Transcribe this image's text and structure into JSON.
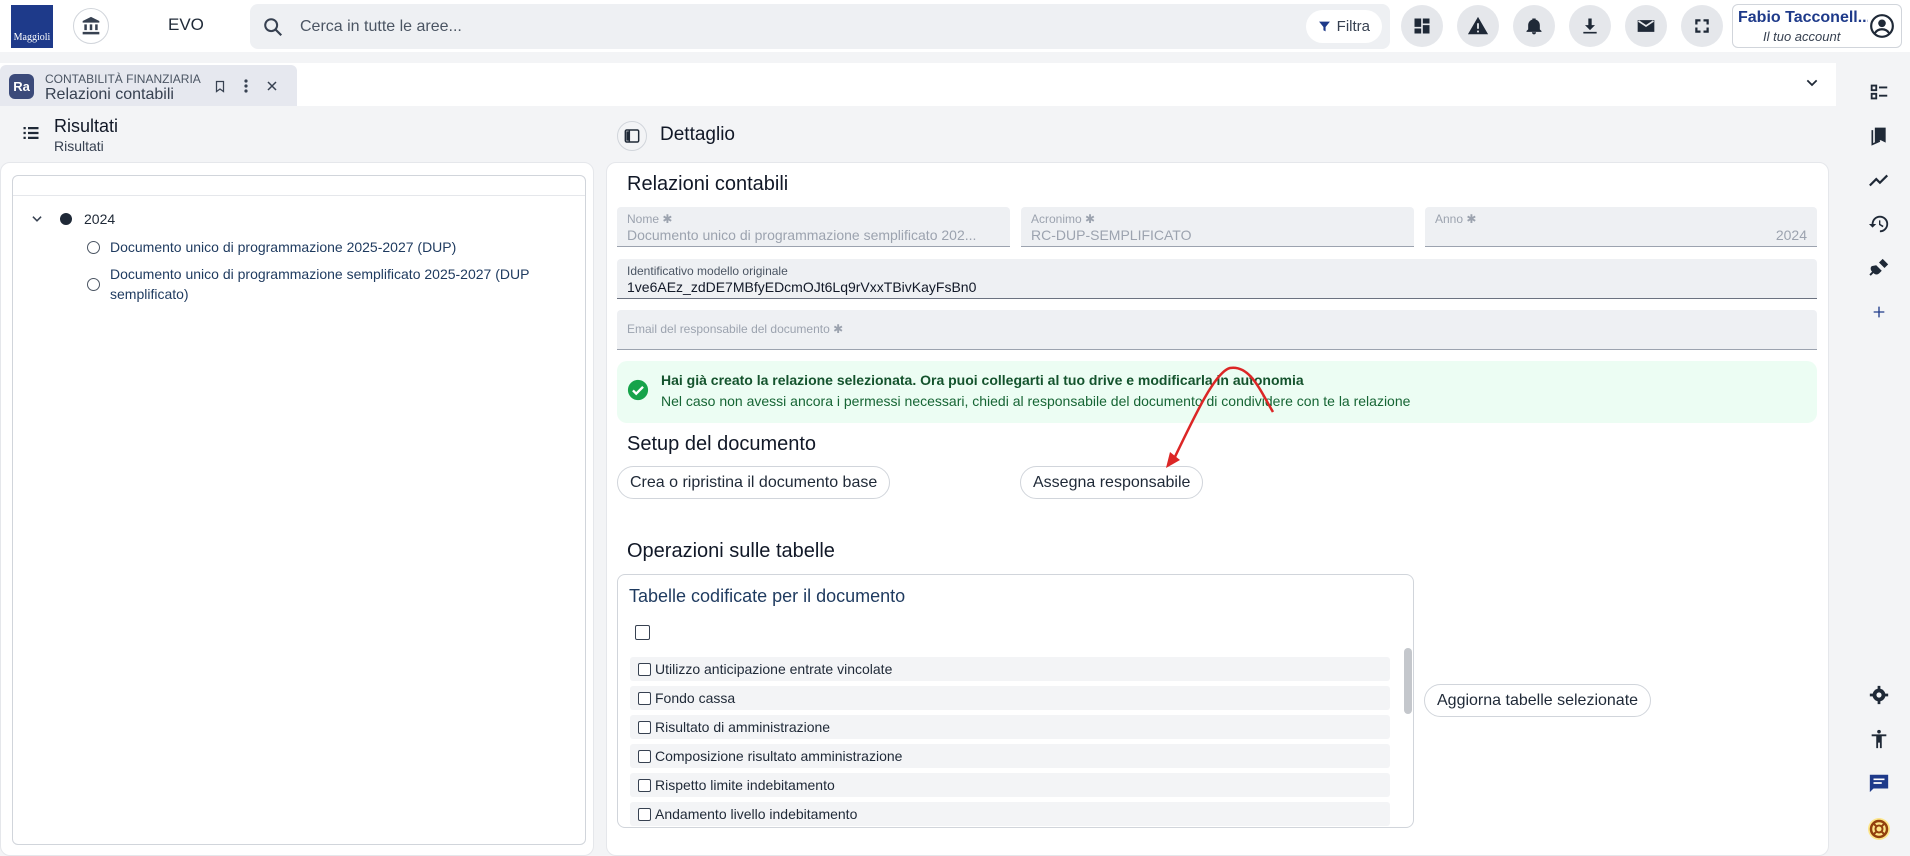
{
  "topbar": {
    "logo_text": "Maggioli",
    "app_name": "EVO",
    "search_placeholder": "Cerca in tutte le aree...",
    "filter_label": "Filtra",
    "user_name": "Fabio Tacconell...",
    "user_sub": "Il tuo account"
  },
  "tab": {
    "badge": "Ra",
    "category": "CONTABILITÀ FINANZIARIA",
    "title": "Relazioni contabili"
  },
  "left_panel": {
    "title": "Risultati",
    "subtitle": "Risultati",
    "tree": {
      "year": "2024",
      "items": [
        {
          "label": "Documento unico di programmazione 2025-2027 (DUP)"
        },
        {
          "label": "Documento unico di programmazione semplificato 2025-2027 (DUP semplificato)"
        }
      ]
    }
  },
  "detail": {
    "header": "Dettaglio",
    "section_title": "Relazioni contabili",
    "fields": {
      "nome": {
        "label": "Nome ✱",
        "value": "Documento unico di programmazione semplificato 202..."
      },
      "acronimo": {
        "label": "Acronimo ✱",
        "value": "RC-DUP-SEMPLIFICATO"
      },
      "anno": {
        "label": "Anno ✱",
        "value": "2024"
      },
      "identificativo": {
        "label": "Identificativo modello originale",
        "value": "1ve6AEz_zdDE7MBfyEDcmOJt6Lq9rVxxTBivKayFsBn0"
      },
      "email": {
        "label": "Email del responsabile del documento ✱",
        "value": ""
      }
    },
    "alert": {
      "title": "Hai già creato la relazione selezionata. Ora puoi collegarti al tuo drive e modificarla in autonomia",
      "text": "Nel caso non avessi ancora i permessi necessari, chiedi al responsabile del documento di condividere con te la relazione"
    },
    "setup_title": "Setup del documento",
    "buttons": {
      "create_base": "Crea o ripristina il documento base",
      "assign": "Assegna responsabile",
      "update_tables": "Aggiorna tabelle selezionate"
    },
    "operations_title": "Operazioni sulle tabelle",
    "tables_card_title": "Tabelle codificate per il documento",
    "tables": [
      {
        "label": "Utilizzo anticipazione entrate vincolate",
        "checked": false
      },
      {
        "label": "Fondo cassa",
        "checked": false
      },
      {
        "label": "Risultato di amministrazione",
        "checked": false
      },
      {
        "label": "Composizione risultato amministrazione",
        "checked": false
      },
      {
        "label": "Rispetto limite indebitamento",
        "checked": false
      },
      {
        "label": "Andamento livello indebitamento",
        "checked": false
      }
    ]
  },
  "colors": {
    "brand": "#1e3a8a",
    "success": "#16a34a",
    "annotation_arrow": "#dc2626"
  }
}
